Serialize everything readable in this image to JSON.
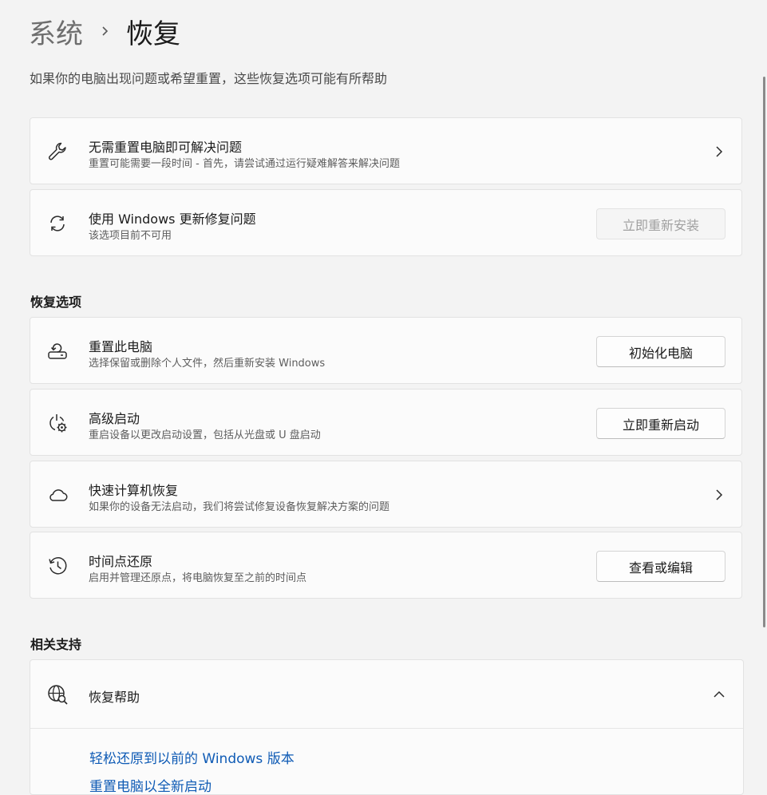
{
  "breadcrumb": {
    "parent": "系统",
    "current": "恢复"
  },
  "subtitle": "如果你的电脑出现问题或希望重置，这些恢复选项可能有所帮助",
  "troubleshoot": {
    "title": "无需重置电脑即可解决问题",
    "desc": "重置可能需要一段时间 - 首先，请尝试通过运行疑难解答来解决问题"
  },
  "windows_update_fix": {
    "title": "使用 Windows 更新修复问题",
    "desc": "该选项目前不可用",
    "button": "立即重新安装"
  },
  "recovery_options": {
    "heading": "恢复选项",
    "reset_pc": {
      "title": "重置此电脑",
      "desc": "选择保留或删除个人文件，然后重新安装 Windows",
      "button": "初始化电脑"
    },
    "advanced_startup": {
      "title": "高级启动",
      "desc": "重启设备以更改启动设置，包括从光盘或 U 盘启动",
      "button": "立即重新启动"
    },
    "quick_recovery": {
      "title": "快速计算机恢复",
      "desc": "如果你的设备无法启动，我们将尝试修复设备恢复解决方案的问题"
    },
    "system_restore": {
      "title": "时间点还原",
      "desc": "启用并管理还原点，将电脑恢复至之前的时间点",
      "button": "查看或编辑"
    }
  },
  "related_support": {
    "heading": "相关支持",
    "help": {
      "title": "恢复帮助",
      "links": [
        "轻松还原到以前的 Windows 版本",
        "重置电脑以全新启动"
      ]
    }
  },
  "colors": {
    "background": "#f3f3f3",
    "card": "#fbfbfb",
    "link": "#0f5bb5",
    "disabled_text": "#a0a0a0"
  },
  "icons": {
    "troubleshoot": "wrench-icon",
    "windows_update_fix": "sync-icon",
    "reset_pc": "reset-pc-icon",
    "advanced_startup": "power-gear-icon",
    "quick_recovery": "cloud-icon",
    "system_restore": "history-icon",
    "help": "globe-search-icon"
  }
}
